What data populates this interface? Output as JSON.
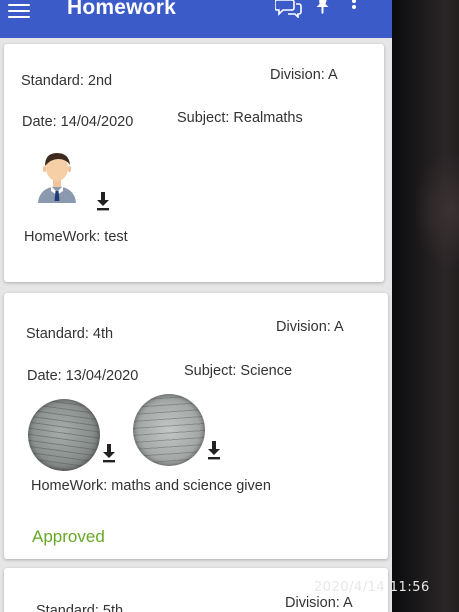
{
  "app": {
    "title": "Homework"
  },
  "icons": {
    "menu": "menu-icon",
    "chat": "chat-icon",
    "pin": "pin-icon",
    "more": "more-vert-icon",
    "download": "download-icon",
    "avatar": "student-avatar-icon"
  },
  "colors": {
    "appbar": "#3b5bc9",
    "approved": "#67a828"
  },
  "cards": [
    {
      "standard": "Standard: 2nd",
      "division": "Division: A",
      "date": "Date: 14/04/2020",
      "subject": "Subject: Realmaths",
      "homework": "HomeWork: test",
      "status": ""
    },
    {
      "standard": "Standard: 4th",
      "division": "Division: A",
      "date": "Date: 13/04/2020",
      "subject": "Subject: Science",
      "homework": "HomeWork: maths and science  given",
      "status": "Approved"
    },
    {
      "standard": "Standard: 5th",
      "division": "Division: A"
    }
  ],
  "overlay": {
    "timestamp": "2020/4/14  11:56"
  }
}
